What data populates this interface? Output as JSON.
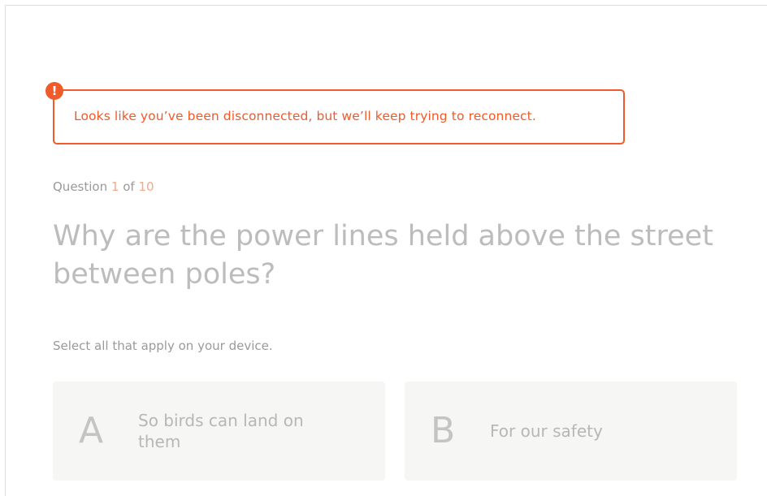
{
  "alert": {
    "icon": "exclamation-icon",
    "icon_glyph": "!",
    "message": "Looks like you’ve been disconnected, but we’ll keep trying to reconnect.",
    "color": "#f15a29"
  },
  "progress": {
    "prefix": "Question",
    "current": "1",
    "separator": "of",
    "total": "10"
  },
  "question": {
    "text": "Why are the power lines held above the street between poles?"
  },
  "instruction": "Select all that apply on your device.",
  "options": [
    {
      "letter": "A",
      "text": "So birds can land on them"
    },
    {
      "letter": "B",
      "text": "For our safety"
    }
  ]
}
